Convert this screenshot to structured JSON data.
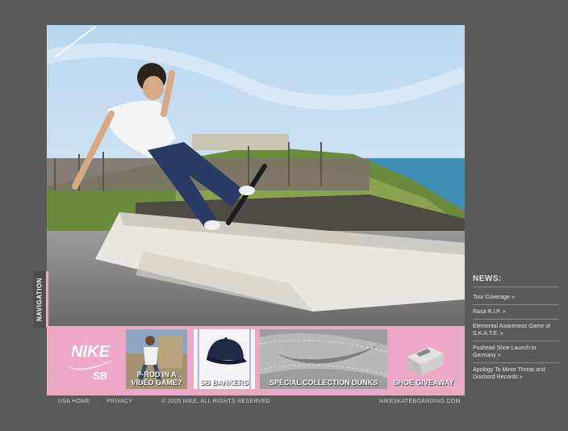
{
  "navigation": {
    "label": "NAVIGATION"
  },
  "promos": [
    {
      "name": "nike-sb-logo",
      "logo_text": "NIKE",
      "logo_sub": "SB"
    },
    {
      "name": "video-game",
      "caption": "P-ROD IN A VIDEO GAME?"
    },
    {
      "name": "sb-bankers",
      "caption": "SB BANKERS"
    },
    {
      "name": "special-collection-dunks",
      "caption": "SPECIAL COLLECTION DUNKS"
    },
    {
      "name": "shoe-giveaway",
      "caption": "SHOE GIVEAWAY"
    }
  ],
  "footer": {
    "home": "USA HOME",
    "privacy": "PRIVACY",
    "copyright": "© 2005 NIKE, ALL RIGHTS RESERVED",
    "site": "NIKESKATEBOARDING.COM"
  },
  "news": {
    "title": "NEWS:",
    "items": [
      "Tour Coverage »",
      "Rasa R.I.P. »",
      "Elemental Awareness Game of S.K.A.T.E. »",
      "Pushead Shoe Launch in Germany »",
      "Apology To Minor Threat and Dischord Records »"
    ]
  },
  "colors": {
    "background": "#5a5a5a",
    "accent_pink": "#e9a8c6"
  }
}
